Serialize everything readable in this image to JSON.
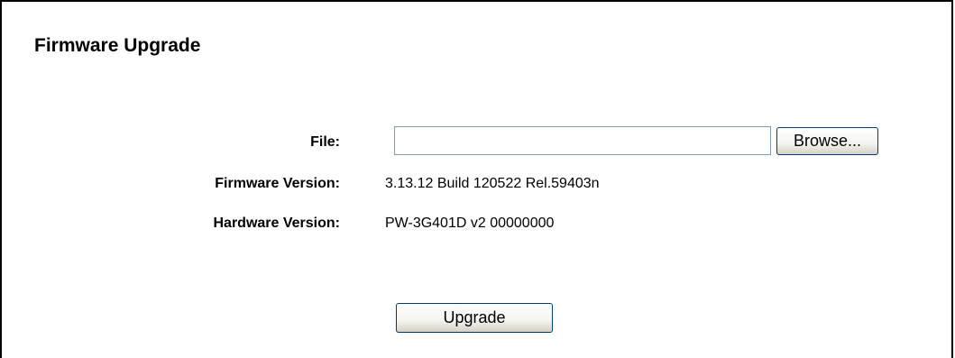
{
  "page": {
    "title": "Firmware Upgrade"
  },
  "form": {
    "file_label": "File:",
    "file_value": "",
    "browse_label": "Browse...",
    "firmware_label": "Firmware Version:",
    "firmware_value": "3.13.12 Build 120522 Rel.59403n",
    "hardware_label": "Hardware Version:",
    "hardware_value": "PW-3G401D v2 00000000",
    "upgrade_label": "Upgrade"
  },
  "colors": {
    "border": "#000000",
    "input_border": "#7f9db9",
    "button_border": "#003c74"
  }
}
